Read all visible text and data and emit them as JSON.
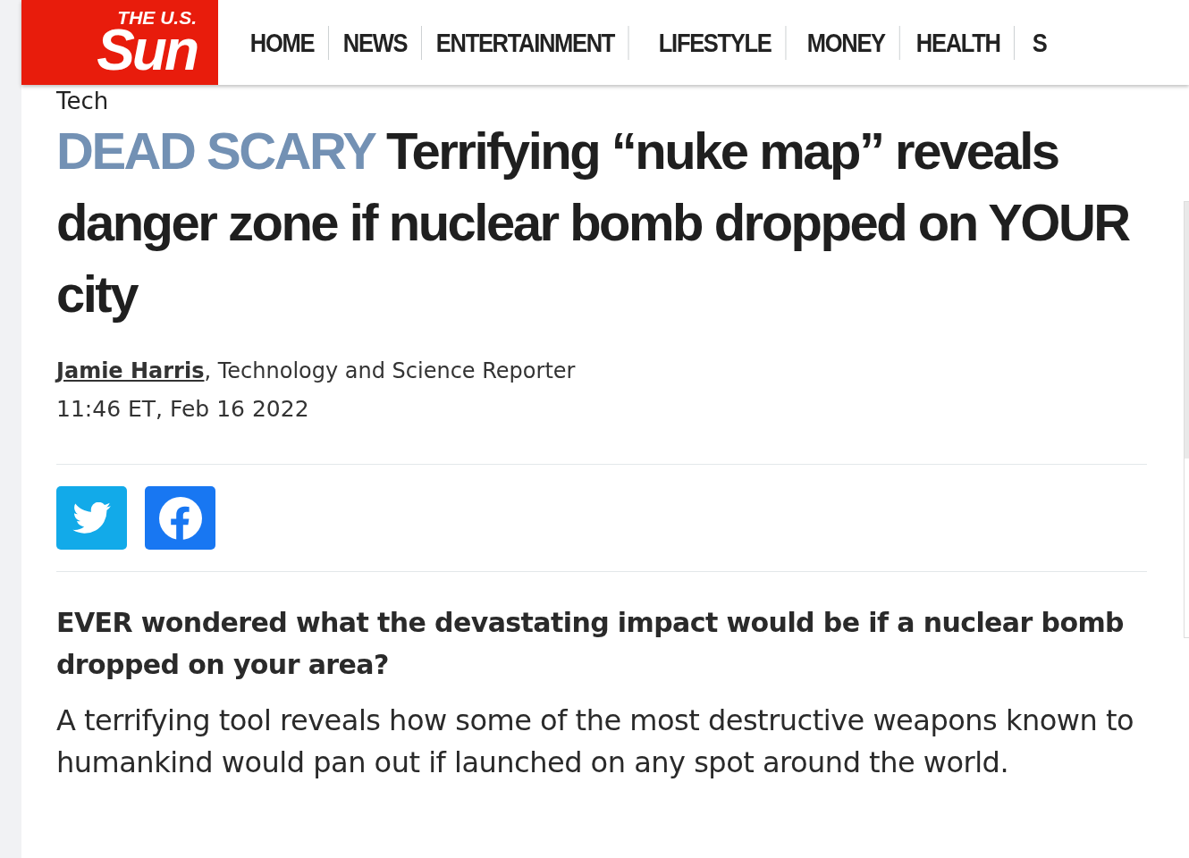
{
  "header": {
    "logo": {
      "small": "THE U.S.",
      "big": "Sun"
    },
    "nav": [
      "HOME",
      "NEWS",
      "ENTERTAINMENT",
      "LIFESTYLE",
      "MONEY",
      "HEALTH",
      "S"
    ]
  },
  "article": {
    "section": "Tech",
    "kicker": "DEAD SCARY",
    "headline": "Terrifying “nuke map” reveals danger zone if nuclear bomb dropped on YOUR city",
    "author": "Jamie Harris",
    "author_role": ", Technology and Science Reporter",
    "timestamp": "11:46 ET, Feb 16 2022",
    "share": [
      {
        "kind": "twitter"
      },
      {
        "kind": "facebook"
      }
    ],
    "standfirst": "EVER wondered what the devastating impact would be if a nuclear bomb dropped on your area?",
    "body": [
      "A terrifying tool reveals how some of the most destructive weapons known to humankind would pan out if launched on any spot around the world."
    ]
  }
}
